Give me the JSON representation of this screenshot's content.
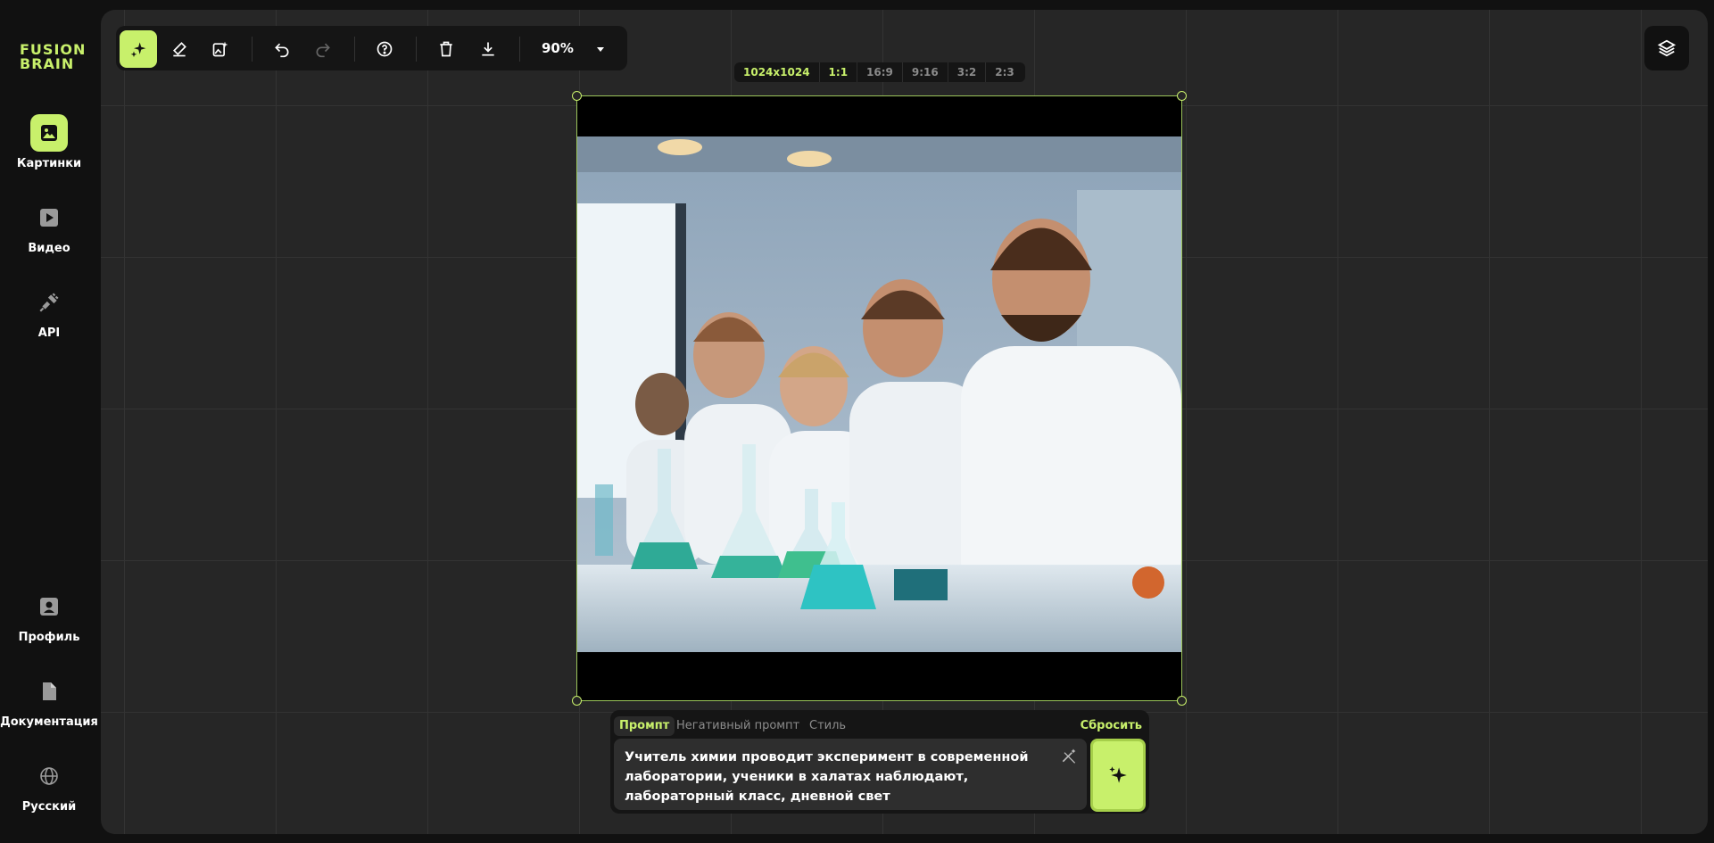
{
  "app": {
    "logo_line1": "FUSION",
    "logo_line2": "BRAIN"
  },
  "sidebar": {
    "items": [
      {
        "label": "Картинки",
        "icon": "image-icon",
        "active": true
      },
      {
        "label": "Видео",
        "icon": "video-play-icon",
        "active": false
      },
      {
        "label": "API",
        "icon": "plug-icon",
        "active": false
      }
    ],
    "bottom_items": [
      {
        "label": "Профиль",
        "icon": "profile-icon"
      },
      {
        "label": "Документация",
        "icon": "document-icon"
      },
      {
        "label": "Русский",
        "icon": "globe-icon"
      }
    ]
  },
  "toolbar": {
    "tools": [
      "generate-sparkle-icon",
      "eraser-icon",
      "image-edit-icon",
      "undo-icon",
      "redo-icon",
      "help-icon",
      "trash-icon",
      "download-icon"
    ],
    "zoom": "90%"
  },
  "canvas": {
    "ratios": [
      "1024x1024",
      "1:1",
      "16:9",
      "9:16",
      "3:2",
      "2:3"
    ],
    "selected_ratio": "1:1"
  },
  "prompt": {
    "tabs": [
      "Промпт",
      "Негативный промпт",
      "Стиль"
    ],
    "active_tab": "Промпт",
    "reset_label": "Сбросить",
    "text": "Учитель химии проводит эксперимент в современной лаборатории, ученики в халатах наблюдают, лабораторный класс, дневной свет"
  },
  "colors": {
    "accent": "#c8f06b",
    "panel": "#151515",
    "canvas": "#262626",
    "background": "#111111"
  }
}
